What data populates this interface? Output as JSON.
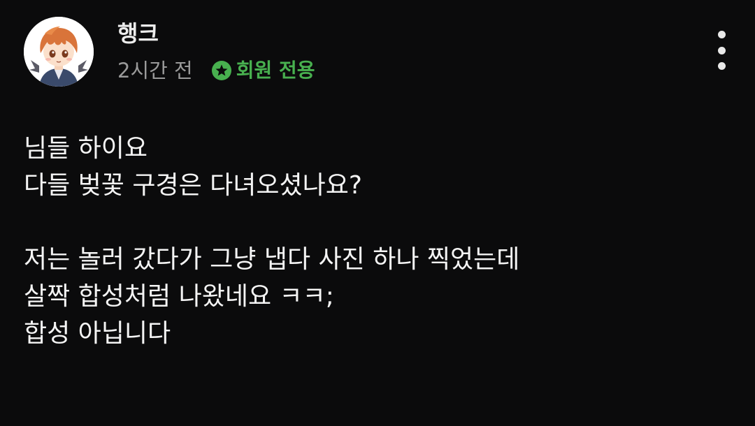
{
  "post": {
    "author": "행크",
    "time": "2시간 전",
    "badge": {
      "icon": "star-circle-icon",
      "label": "회원 전용",
      "color": "#48b04f"
    },
    "menu_icon": "more-vertical-icon",
    "lines": [
      "님들 하이요",
      "다들 벚꽃 구경은 다녀오셨나요?",
      "",
      "저는 놀러 갔다가 그냥 냅다 사진 하나 찍었는데",
      "살짝 합성처럼 나왔네요 ㅋㅋ;",
      "합성 아닙니다"
    ]
  },
  "colors": {
    "background": "#0b0b0c",
    "text": "#f4f4f4",
    "muted": "#9a9a9a",
    "accent": "#48b04f"
  }
}
